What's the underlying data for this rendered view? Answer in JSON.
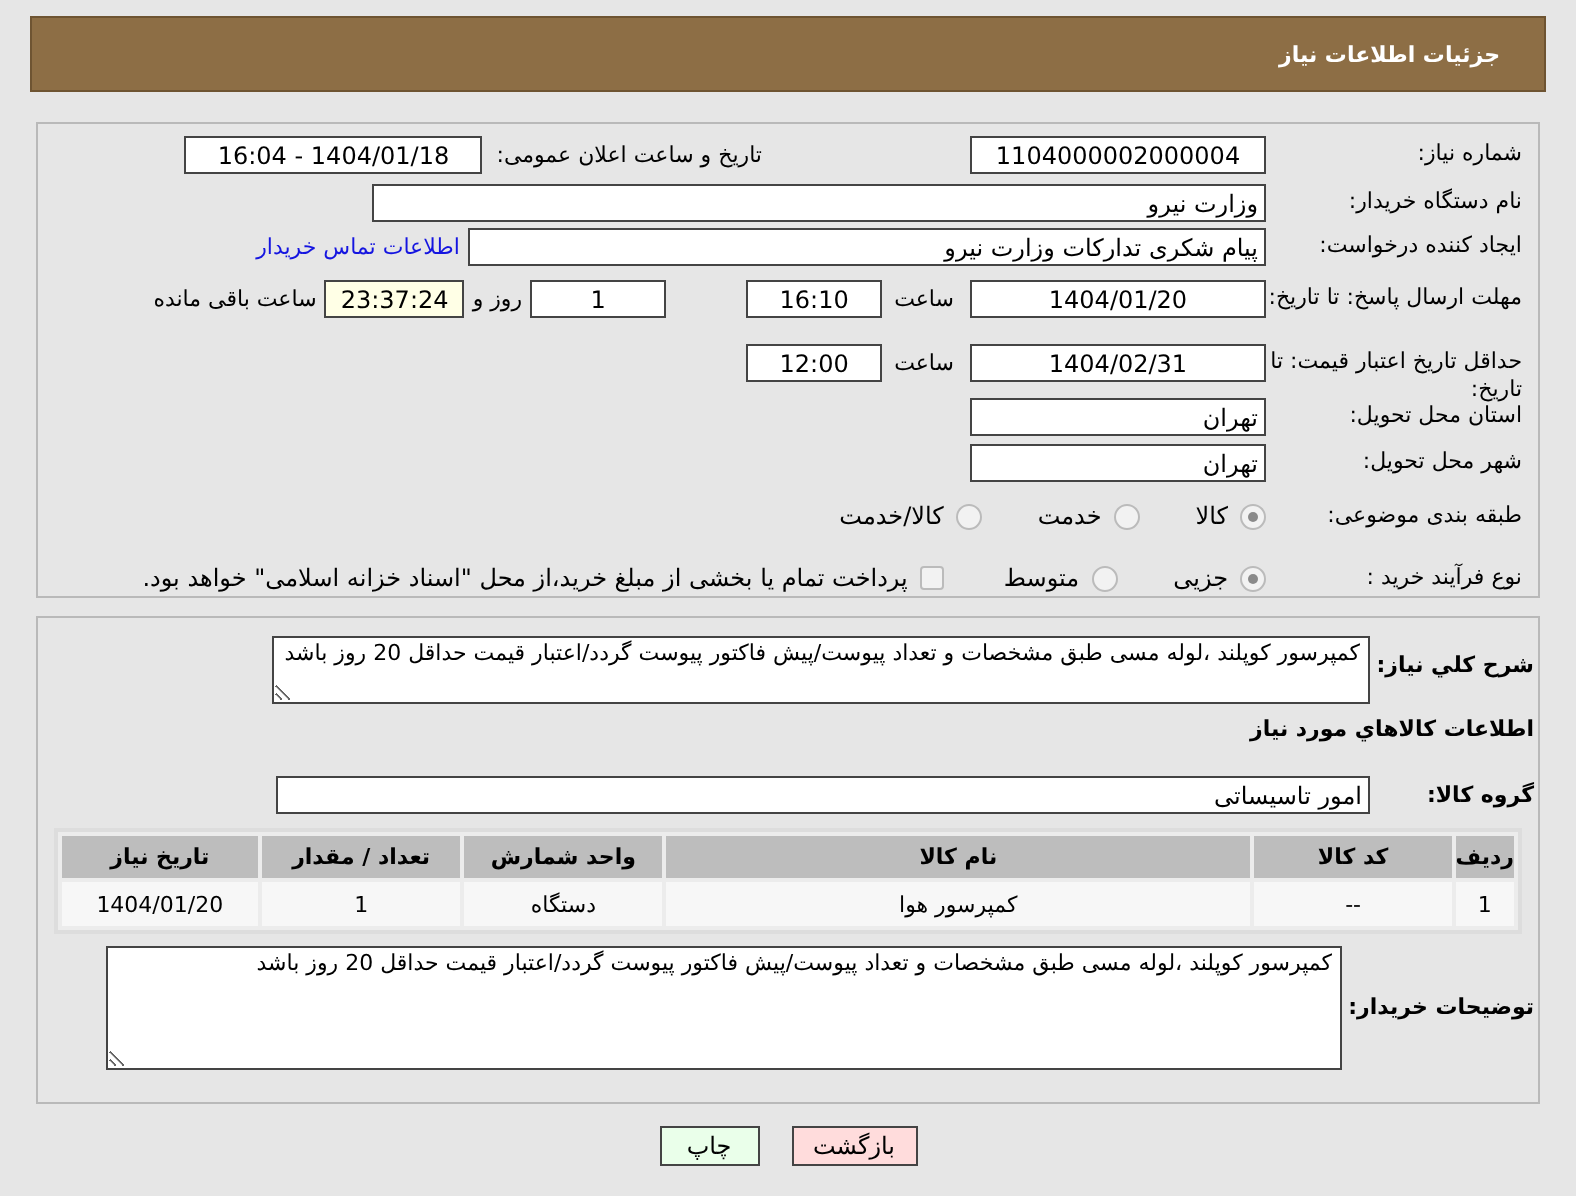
{
  "header": {
    "title": "جزئیات اطلاعات نیاز"
  },
  "form": {
    "need_number": {
      "label": "شماره نیاز:",
      "value": "1104000002000004"
    },
    "announce": {
      "label": "تاریخ و ساعت اعلان عمومی:",
      "value": "1404/01/18 - 16:04"
    },
    "buyer_org": {
      "label": "نام دستگاه خریدار:",
      "value": "وزارت نیرو"
    },
    "requester": {
      "label": "ایجاد کننده درخواست:",
      "value": "پیام شکری تدارکات وزارت نیرو",
      "link": "اطلاعات تماس خریدار"
    },
    "reply_deadline": {
      "label": "مهلت ارسال پاسخ: تا تاریخ:",
      "date": "1404/01/20",
      "time_label": "ساعت",
      "time": "16:10",
      "days": "1",
      "days_label": "روز و",
      "remaining": "23:37:24",
      "remaining_label": "ساعت باقی مانده"
    },
    "price_validity": {
      "label": "حداقل تاریخ اعتبار قیمت: تا تاریخ:",
      "date": "1404/02/31",
      "time_label": "ساعت",
      "time": "12:00"
    },
    "province": {
      "label": "استان محل تحویل:",
      "value": "تهران"
    },
    "city": {
      "label": "شهر محل تحویل:",
      "value": "تهران"
    },
    "category": {
      "label": "طبقه بندی موضوعی:",
      "options": [
        {
          "label": "کالا",
          "selected": true
        },
        {
          "label": "خدمت",
          "selected": false
        },
        {
          "label": "کالا/خدمت",
          "selected": false
        }
      ]
    },
    "process": {
      "label": "نوع فرآیند خرید :",
      "options": [
        {
          "label": "جزیی",
          "selected": true
        },
        {
          "label": "متوسط",
          "selected": false
        }
      ],
      "payment_note": {
        "checked": false,
        "text": "پرداخت تمام یا بخشی از مبلغ خرید،از محل \"اسناد خزانه اسلامی\" خواهد بود."
      }
    }
  },
  "details": {
    "description": {
      "label": "شرح کلي نیاز:",
      "value": "کمپرسور کوپلند ،لوله مسی طبق مشخصات و تعداد پیوست/پیش فاکتور پیوست گردد/اعتبار قیمت حداقل 20 روز باشد"
    },
    "goods_title": "اطلاعات کالاهاي مورد نیاز",
    "goods_group": {
      "label": "گروه کالا:",
      "value": "امور تاسیساتی"
    },
    "table": {
      "columns": [
        "ردیف",
        "کد کالا",
        "نام کالا",
        "واحد شمارش",
        "تعداد / مقدار",
        "تاریخ نیاز"
      ],
      "rows": [
        [
          "1",
          "--",
          "کمپرسور هوا",
          "دستگاه",
          "1",
          "1404/01/20"
        ]
      ]
    },
    "buyer_notes": {
      "label": "توضیحات خریدار:",
      "value": "کمپرسور کوپلند ،لوله مسی طبق مشخصات و تعداد پیوست/پیش فاکتور پیوست گردد/اعتبار قیمت حداقل 20 روز باشد"
    }
  },
  "buttons": [
    {
      "label": "بازگشت",
      "kind": "back"
    },
    {
      "label": "چاپ",
      "kind": "print"
    }
  ]
}
